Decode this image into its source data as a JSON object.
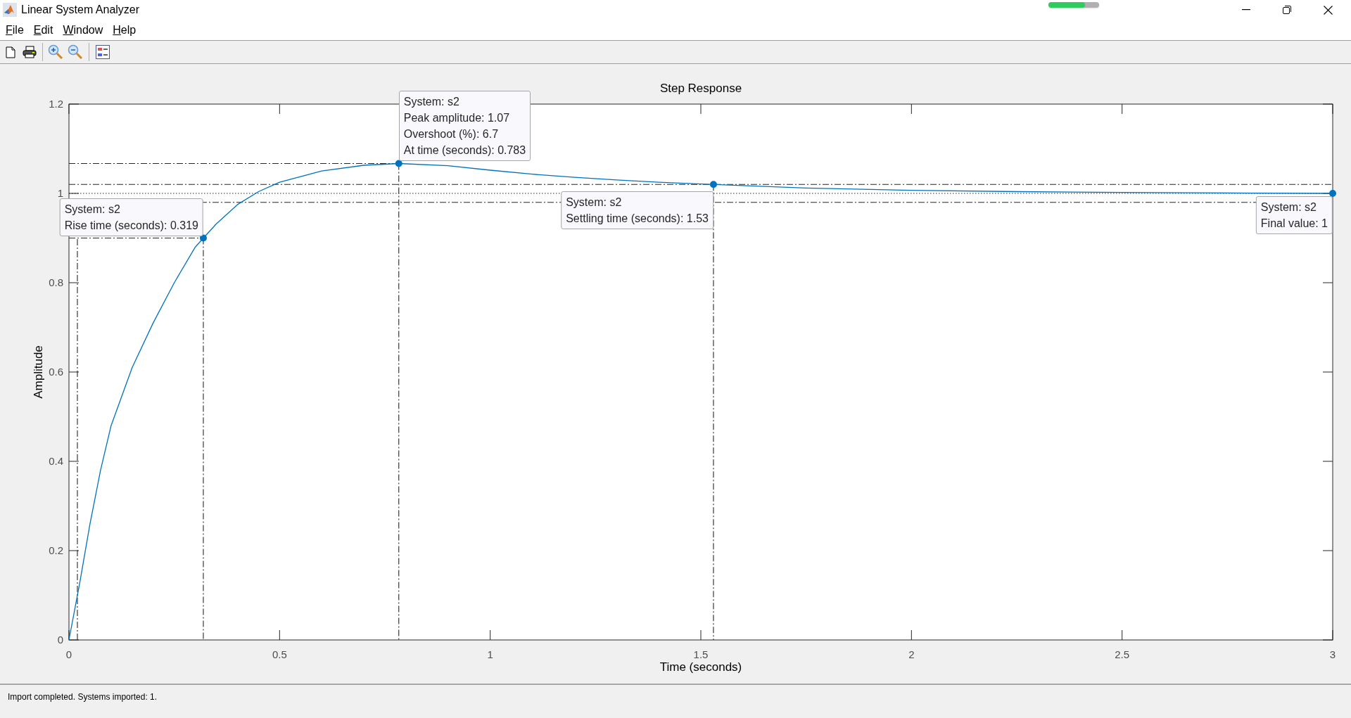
{
  "window": {
    "title": "Linear System Analyzer"
  },
  "progress": {
    "level": 0.72
  },
  "menu": [
    {
      "label": "File"
    },
    {
      "label": "Edit"
    },
    {
      "label": "Window"
    },
    {
      "label": "Help"
    }
  ],
  "plot": {
    "chart_data": {
      "type": "line",
      "title": "Step Response",
      "xlabel": "Time (seconds)",
      "ylabel": "Amplitude",
      "x": [
        0,
        0.025,
        0.05,
        0.075,
        0.1,
        0.15,
        0.2,
        0.25,
        0.3,
        0.319,
        0.35,
        0.4,
        0.45,
        0.5,
        0.6,
        0.7,
        0.783,
        0.9,
        1.0,
        1.1,
        1.2,
        1.3,
        1.4,
        1.53,
        1.75,
        2.0,
        2.25,
        2.5,
        2.75,
        3.0
      ],
      "series": [
        {
          "color": "#0072bd",
          "values": [
            0,
            0.125,
            0.26,
            0.38,
            0.48,
            0.61,
            0.71,
            0.8,
            0.88,
            0.9,
            0.932,
            0.975,
            1.004,
            1.025,
            1.05,
            1.063,
            1.067,
            1.062,
            1.052,
            1.043,
            1.036,
            1.03,
            1.025,
            1.02,
            1.012,
            1.007,
            1.004,
            1.002,
            1.001,
            1.0
          ]
        }
      ],
      "xlim": [
        0,
        3
      ],
      "ylim": [
        0,
        1.2
      ],
      "xticks": [
        0,
        0.5,
        1,
        1.5,
        2,
        2.5,
        3
      ],
      "yticks": [
        0,
        0.2,
        0.4,
        0.6,
        0.8,
        1,
        1.2
      ],
      "ref_lines": [
        {
          "axis": "x",
          "value": 0.02
        },
        {
          "axis": "y",
          "value": 1.02
        },
        {
          "axis": "y",
          "value": 0.98
        },
        {
          "axis": "y",
          "value": 1.0
        }
      ],
      "annotations": [
        {
          "x": 0.319,
          "y": 0.9,
          "text": "System: s2\nRise time (seconds): 0.319"
        },
        {
          "x": 0.783,
          "y": 1.067,
          "text": "System: s2\nPeak amplitude: 1.07\nOvershoot (%): 6.7\nAt time (seconds): 0.783"
        },
        {
          "x": 1.53,
          "y": 1.02,
          "text": "System: s2\nSettling time (seconds): 1.53"
        },
        {
          "x": 3.0,
          "y": 1.0,
          "text": "System: s2\nFinal value: 1"
        }
      ]
    }
  },
  "status_bar": {
    "text": "Import completed. Systems imported: 1."
  }
}
